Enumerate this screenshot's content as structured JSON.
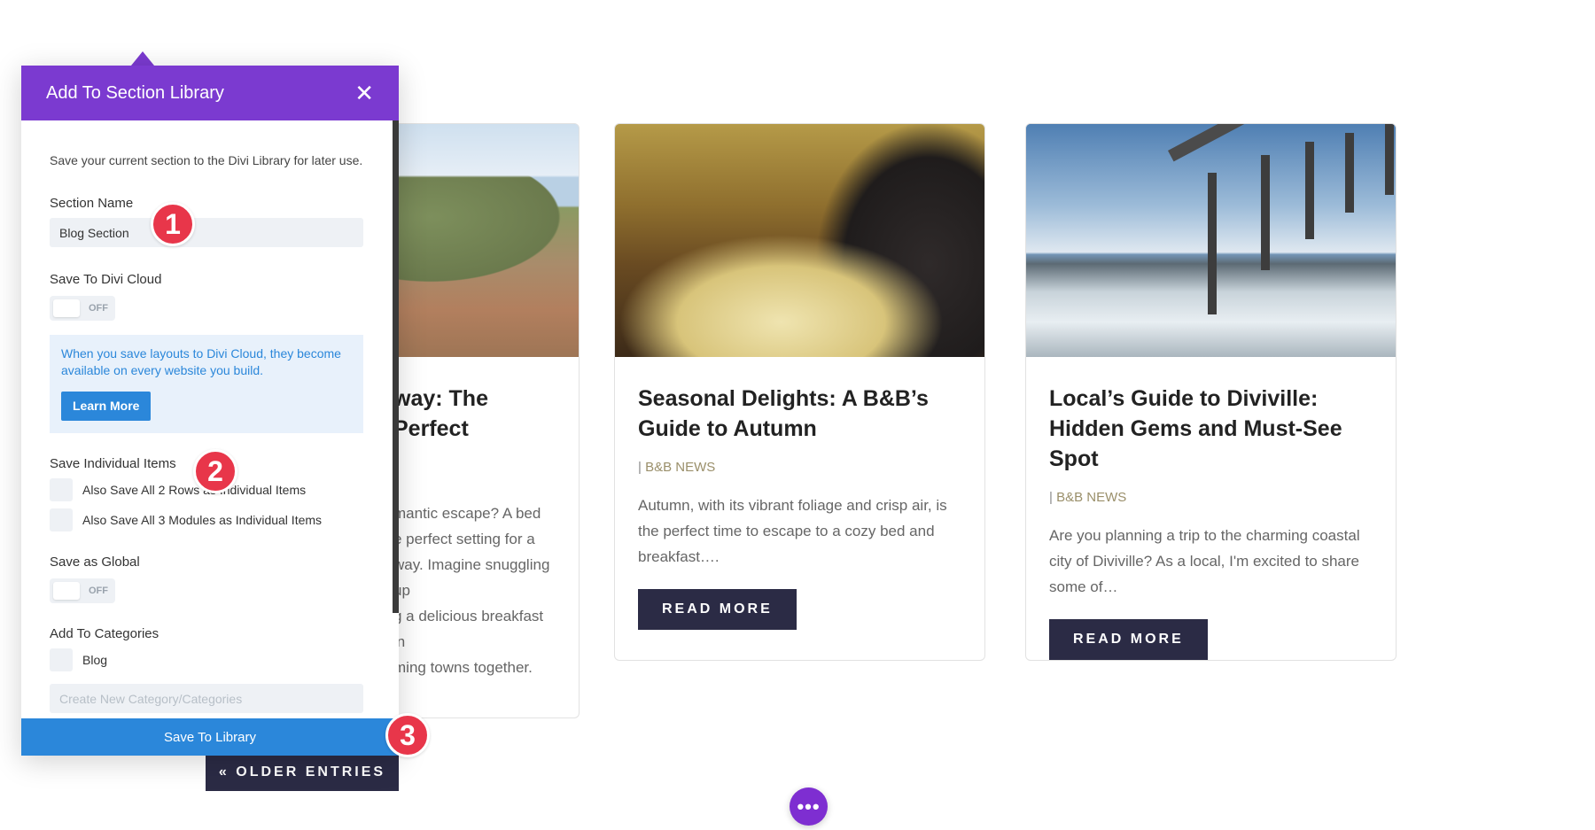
{
  "modal": {
    "title": "Add To Section Library",
    "close_icon": "close-icon",
    "description": "Save your current section to the Divi Library for later use.",
    "section_name_label": "Section Name",
    "section_name_value": "Blog Section",
    "divi_cloud_label": "Save To Divi Cloud",
    "divi_cloud_toggle": "OFF",
    "info_text": "When you save layouts to Divi Cloud, they become available on every website you build.",
    "learn_more": "Learn More",
    "individual_items_label": "Save Individual Items",
    "individual_items": [
      "Also Save All 2 Rows as Individual Items",
      "Also Save All 3 Modules as Individual Items"
    ],
    "global_label": "Save as Global",
    "global_toggle": "OFF",
    "categories_label": "Add To Categories",
    "categories": [
      "Blog"
    ],
    "category_placeholder": "Create New Category/Categories",
    "save_button": "Save To Library"
  },
  "badges": [
    "1",
    "2",
    "3"
  ],
  "posts": [
    {
      "title_visible": "way: The Perfect",
      "excerpt_lines": [
        "mantic escape? A bed",
        "e perfect setting for a",
        "way. Imagine snuggling up",
        "g a delicious breakfast in",
        "ming towns together."
      ]
    },
    {
      "title": "Seasonal Delights: A B&B’s Guide to Autumn",
      "meta_prefix": "| ",
      "category": "B&B NEWS",
      "excerpt": "Autumn, with its vibrant foliage and crisp air, is the perfect time to escape to a cozy bed and breakfast….",
      "button": "READ MORE"
    },
    {
      "title": "Local’s Guide to Diviville: Hidden Gems and Must-See Spot",
      "meta_prefix": "| ",
      "category": "B&B NEWS",
      "excerpt": "Are you planning a trip to the charming coastal city of Diviville? As a local, I'm excited to share some of…",
      "button": "READ MORE"
    }
  ],
  "older_entries": "« OLDER ENTRIES",
  "dots_button": "•••",
  "colors": {
    "purple": "#7b3ad0",
    "blue": "#2b87da",
    "navy": "#2b2b45",
    "badge_red": "#e8364a"
  }
}
